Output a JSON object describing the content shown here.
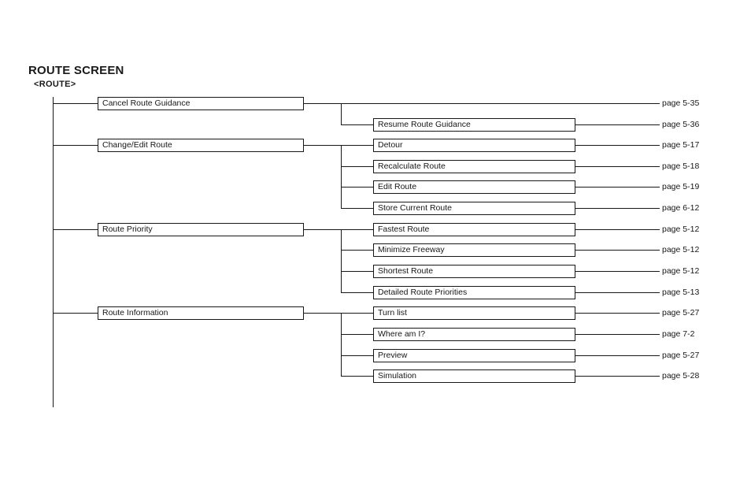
{
  "document": {
    "title": "ROUTE SCREEN",
    "subtitle": "<ROUTE>"
  },
  "tree": {
    "groups": [
      {
        "id": "cancel-route-guidance",
        "parent": "Cancel Route Guidance",
        "parent_page": "page 5-35",
        "children": [
          {
            "label": "Resume Route Guidance",
            "page": "page 5-36"
          }
        ]
      },
      {
        "id": "change-edit-route",
        "parent": "Change/Edit Route",
        "parent_page": "",
        "children": [
          {
            "label": "Detour",
            "page": "page 5-17"
          },
          {
            "label": "Recalculate Route",
            "page": "page 5-18"
          },
          {
            "label": "Edit Route",
            "page": "page 5-19"
          },
          {
            "label": "Store Current Route",
            "page": "page 6-12"
          }
        ]
      },
      {
        "id": "route-priority",
        "parent": "Route Priority",
        "parent_page": "",
        "children": [
          {
            "label": "Fastest Route",
            "page": "page 5-12"
          },
          {
            "label": "Minimize Freeway",
            "page": "page 5-12"
          },
          {
            "label": "Shortest Route",
            "page": "page 5-12"
          },
          {
            "label": "Detailed Route Priorities",
            "page": "page 5-13"
          }
        ]
      },
      {
        "id": "route-information",
        "parent": "Route Information",
        "parent_page": "",
        "children": [
          {
            "label": "Turn list",
            "page": "page 5-27"
          },
          {
            "label": "Where am I?",
            "page": "page 7-2"
          },
          {
            "label": "Preview",
            "page": "page 5-27"
          },
          {
            "label": "Simulation",
            "page": "page 5-28"
          }
        ]
      }
    ]
  },
  "rows": {
    "labels": [
      "Cancel Route Guidance",
      "Resume Route Guidance",
      "Detour",
      "Recalculate Route",
      "Edit Route",
      "Store Current Route",
      "Fastest Route",
      "Minimize Freeway",
      "Shortest Route",
      "Detailed Route Priorities",
      "Turn list",
      "Where am I?",
      "Preview",
      "Simulation"
    ],
    "pages": [
      "page 5-35",
      "page 5-36",
      "page 5-17",
      "page 5-18",
      "page 5-19",
      "page 6-12",
      "page 5-12",
      "page 5-12",
      "page 5-12",
      "page 5-13",
      "page 5-27",
      "page 7-2",
      "page 5-27",
      "page 5-28"
    ]
  },
  "level1_nodes": [
    "Cancel Route Guidance",
    "Change/Edit Route",
    "Route Priority",
    "Route Information"
  ],
  "colors": {
    "line": "#171717",
    "text": "#171717",
    "background": "#ffffff"
  }
}
